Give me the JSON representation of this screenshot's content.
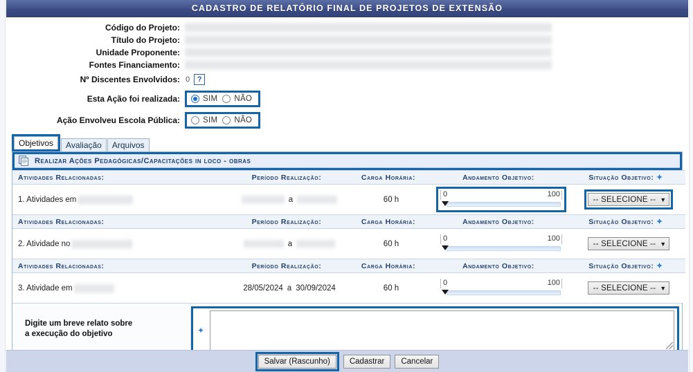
{
  "header": {
    "title": "CADASTRO DE RELATÓRIO FINAL DE PROJETOS DE EXTENSÃO"
  },
  "form": {
    "fields": [
      {
        "label": "Código do Projeto:",
        "value": "",
        "redacted": true
      },
      {
        "label": "Título do Projeto:",
        "value": "",
        "redacted": true
      },
      {
        "label": "Unidade Proponente:",
        "value": "",
        "redacted": true
      },
      {
        "label": "Fontes Financiamento:",
        "value": "",
        "redacted": true
      }
    ],
    "discentes": {
      "label": "Nº Discentes Envolvidos:",
      "value": "0",
      "help_icon": "question-icon",
      "help_text": "?"
    },
    "realizada": {
      "label": "Esta Ação foi realizada:",
      "options": [
        {
          "label": "SIM",
          "checked": true
        },
        {
          "label": "NÃO",
          "checked": false
        }
      ],
      "highlighted": true
    },
    "escola_publica": {
      "label": "Ação Envolveu Escola Pública:",
      "options": [
        {
          "label": "SIM",
          "checked": false
        },
        {
          "label": "NÃO",
          "checked": false
        }
      ],
      "highlighted": true
    }
  },
  "tabs": [
    {
      "label": "Objetivos",
      "active": true,
      "highlighted": true
    },
    {
      "label": "Avaliação",
      "active": false,
      "highlighted": false
    },
    {
      "label": "Arquivos",
      "active": false,
      "highlighted": false
    }
  ],
  "objective": {
    "icon": "documents-icon",
    "title": "Realizar Ações Pedagógicas/Capacitações in loco - obras",
    "highlighted": true
  },
  "table": {
    "columns": [
      "Atividades Relacionadas:",
      "Período Realização:",
      "Carga Horária:",
      "Andamento Objetivo:",
      "Situação Objetivo:"
    ],
    "situacao_required_marker": "✦",
    "rows": [
      {
        "atividade": "1. Atividades em",
        "atividade_redacted": true,
        "periodo_inicio": "",
        "periodo_fim": "",
        "periodo_redacted": true,
        "periodo_sep": "a",
        "carga_horaria": "60 h",
        "slider_min": "0",
        "slider_max": "100",
        "slider_value": 0,
        "slider_highlighted": true,
        "situacao": "-- SELECIONE --",
        "situacao_highlighted": true
      },
      {
        "atividade": "2. Atividade no",
        "atividade_redacted": true,
        "periodo_inicio": "",
        "periodo_fim": "",
        "periodo_redacted": true,
        "periodo_sep": "a",
        "carga_horaria": "60 h",
        "slider_min": "0",
        "slider_max": "100",
        "slider_value": 0,
        "slider_highlighted": false,
        "situacao": "-- SELECIONE --",
        "situacao_highlighted": false
      },
      {
        "atividade": "3. Atividade em",
        "atividade_redacted": true,
        "periodo_inicio": "28/05/2024",
        "periodo_fim": "30/09/2024",
        "periodo_redacted": false,
        "periodo_sep": "a",
        "carga_horaria": "60 h",
        "slider_min": "0",
        "slider_max": "100",
        "slider_value": 0,
        "slider_highlighted": false,
        "situacao": "-- SELECIONE --",
        "situacao_highlighted": false
      }
    ]
  },
  "relato": {
    "label_line1": "Digite um breve relato sobre",
    "label_line2": "a execução do objetivo",
    "required_marker": "✦",
    "value": "",
    "highlighted": true
  },
  "footer": {
    "buttons": [
      {
        "label": "Salvar (Rascunho)",
        "highlighted": true
      },
      {
        "label": "Cadastrar",
        "highlighted": false
      },
      {
        "label": "Cancelar",
        "highlighted": false
      }
    ]
  },
  "colors": {
    "highlight": "#1464aa",
    "titlebar": "#3c4d85",
    "header_band": "#eef3fa",
    "footer_bg": "#ccd5ea",
    "accent_text": "#22406e"
  }
}
